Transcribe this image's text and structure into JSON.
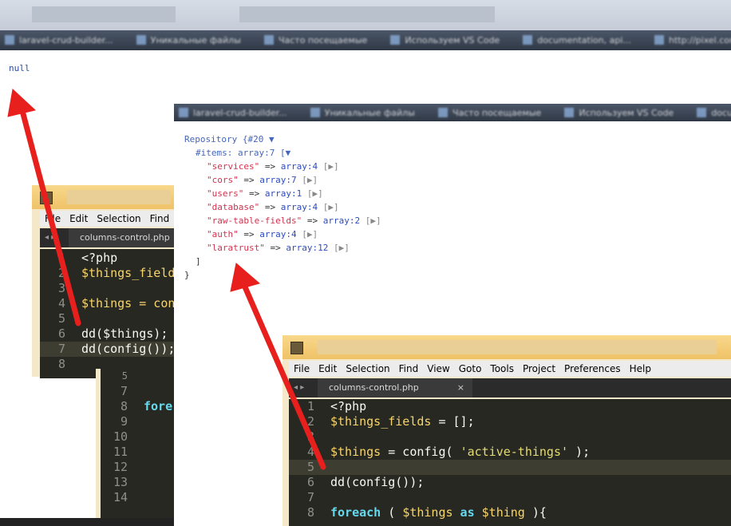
{
  "browser": {
    "bookmarks": [
      "laravel-crud-builder...",
      "Уникальные файлы",
      "Часто посещаемые",
      "Используем VS Code",
      "documentation, api...",
      "http://pixel.com/ru"
    ]
  },
  "output": {
    "null_text": "null"
  },
  "dump": {
    "bookmarks": [
      "laravel-crud-builder...",
      "Уникальные файлы",
      "Часто посещаемые",
      "Используем VS Code",
      "documentation, api..."
    ],
    "class_line": "Repository {#20 ▼",
    "items_label": "#items: array:7 [▼",
    "items": [
      {
        "key": "\"services\"",
        "value": "array:4",
        "toggle": "[▶]"
      },
      {
        "key": "\"cors\"",
        "value": "array:7",
        "toggle": "[▶]"
      },
      {
        "key": "\"users\"",
        "value": "array:1",
        "toggle": "[▶]"
      },
      {
        "key": "\"database\"",
        "value": "array:4",
        "toggle": "[▶]"
      },
      {
        "key": "\"raw-table-fields\"",
        "value": "array:2",
        "toggle": "[▶]"
      },
      {
        "key": "\"auth\"",
        "value": "array:4",
        "toggle": "[▶]"
      },
      {
        "key": "\"laratrust\"",
        "value": "array:12",
        "toggle": "[▶]"
      }
    ],
    "close_bracket": "]",
    "close_brace": "}"
  },
  "editor_back": {
    "menu": [
      "File",
      "Edit",
      "Selection",
      "Find"
    ],
    "tab_name": "columns-control.php",
    "gutter": [
      "1",
      "2",
      "3",
      "4",
      "5",
      "6",
      "7",
      "8"
    ],
    "lines": [
      "<?php",
      "$things_field",
      "",
      "$things = con",
      "",
      "dd($things);",
      "dd(config());",
      ""
    ]
  },
  "editor_mid": {
    "gutter": [
      "5",
      "7",
      "8",
      "9",
      "10",
      "11",
      "12",
      "13",
      "14"
    ],
    "lines": [
      "",
      "",
      "fore",
      "",
      "",
      "",
      "",
      "",
      ""
    ]
  },
  "editor_front": {
    "menu": [
      "File",
      "Edit",
      "Selection",
      "Find",
      "View",
      "Goto",
      "Tools",
      "Project",
      "Preferences",
      "Help"
    ],
    "tab_name": "columns-control.php",
    "tab_close": "×",
    "gutter": [
      "1",
      "2",
      "3",
      "4",
      "5",
      "6",
      "7",
      "8"
    ],
    "line1": "<?php",
    "line2_var": "$things_fields",
    "line2_rest": " = [];",
    "line4_var": "$things",
    "line4_mid": " = config( ",
    "line4_str": "'active-things'",
    "line4_end": " );",
    "line6": "dd(config());",
    "line8_kw": "foreach",
    "line8_a": " ( ",
    "line8_var": "$things",
    "line8_as": " as ",
    "line8_var2": "$thing",
    "line8_end": " ){"
  },
  "colors": {
    "arrow": "#e8201d",
    "editor_bg": "#272822",
    "title_bar": "#f0c36a"
  }
}
